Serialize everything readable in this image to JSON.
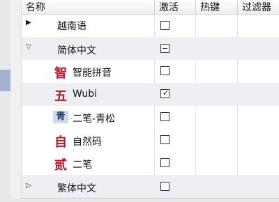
{
  "columns": {
    "name": "名称",
    "active": "激活",
    "hotkey": "热键",
    "filter": "过滤器"
  },
  "rows": [
    {
      "label": "越南语",
      "type": "group",
      "expanded": false,
      "checkbox": "unchecked",
      "glyph": ""
    },
    {
      "label": "简体中文",
      "type": "group",
      "expanded": true,
      "checkbox": "partial",
      "glyph": ""
    },
    {
      "label": "智能拼音",
      "type": "item",
      "checkbox": "unchecked",
      "glyph": "智"
    },
    {
      "label": "Wubi",
      "type": "item",
      "checkbox": "checked",
      "glyph": "五",
      "selected": true
    },
    {
      "label": "二笔-青松",
      "type": "item",
      "checkbox": "unchecked",
      "glyph": "青"
    },
    {
      "label": "自然码",
      "type": "item",
      "checkbox": "unchecked",
      "glyph": "自"
    },
    {
      "label": "二笔",
      "type": "item",
      "checkbox": "unchecked",
      "glyph": "贰"
    },
    {
      "label": "繁体中文",
      "type": "group",
      "expanded": false,
      "checkbox": "unchecked",
      "glyph": ""
    }
  ],
  "icons": {
    "collapsed": "triangle-right-icon",
    "expanded": "triangle-down-icon",
    "checkmark": "✓",
    "check_partial": "dash-icon"
  },
  "colors": {
    "header_bg": "#eeeeee",
    "selected_row": "#eeeff3",
    "glyph_red": "#b8182a",
    "glyph_blue": "#233a66"
  }
}
